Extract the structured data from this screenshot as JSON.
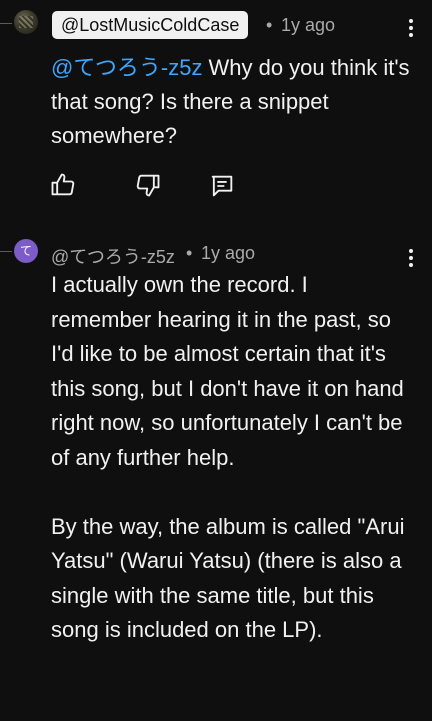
{
  "comment1": {
    "author_handle": "@LostMusicColdCase",
    "separator": "•",
    "age": "1y ago",
    "mention": "@てつろう-z5z",
    "text": "Why do you think it's that song? Is there a snippet somewhere?",
    "actions": [
      "thumbs-up-icon",
      "thumbs-down-icon",
      "reply-icon"
    ]
  },
  "comment2": {
    "avatar_letter": "て",
    "avatar_color": "#7c5dc7",
    "author_handle": "@てつろう-z5z",
    "separator": "•",
    "age": "1y ago",
    "paragraphs": [
      "I actually own the record. I remember hearing it in the past, so I'd like to be almost certain that it's this song, but I don't have it on hand right now, so unfortunately I can't be of any further help.",
      "By the way, the album is called \"Arui Yatsu\" (Warui Yatsu) (there is also a single with the same title, but this song is included on the LP)."
    ]
  },
  "colors": {
    "background": "#0f0f0f",
    "text": "#f1f1f1",
    "meta": "#aaaaaa",
    "mention": "#3ea6ff"
  }
}
